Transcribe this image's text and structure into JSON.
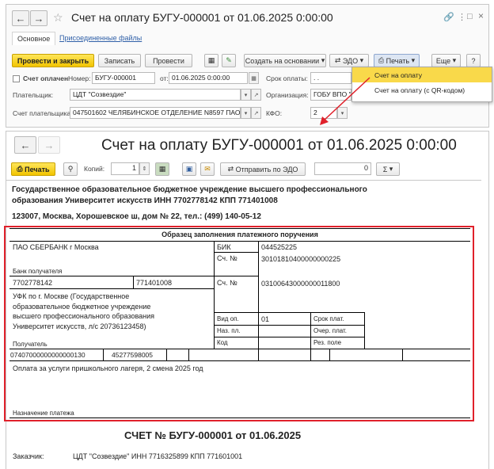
{
  "form": {
    "title": "Счет на оплату БУГУ-000001 от 01.06.2025 0:00:00",
    "tabs": [
      "Основное",
      "Присоединенные файлы"
    ],
    "toolbar": {
      "post_close": "Провести и закрыть",
      "save": "Записать",
      "post": "Провести",
      "create_based": "Создать на основании",
      "edo": "ЭДО",
      "print": "Печать",
      "more": "Еще",
      "help": "?"
    },
    "fields": {
      "paid_label": "Счет оплачен",
      "number_label": "Номер:",
      "number_value": "БУГУ-000001",
      "date_label": "от:",
      "date_value": "01.06.2025  0:00:00",
      "due_label": "Срок оплаты:",
      "due_value": " .  .",
      "payer_label": "Плательщик:",
      "payer_value": "ЦДТ \"Созвездие\"",
      "org_label": "Организация:",
      "org_value": "ГОБУ ВПО \"У",
      "account_label": "Счет плательщика:",
      "account_value": "047501602 ЧЕЛЯБИНСКОЕ ОТДЕЛЕНИЕ N8597 ПАО",
      "kfo_label": "КФО:",
      "kfo_value": "2"
    },
    "print_menu": [
      "Счет на оплату",
      "Счет на оплату (с QR-кодом)"
    ]
  },
  "print_form": {
    "title": "Счет на оплату БУГУ-000001 от 01.06.2025 0:00:00",
    "toolbar": {
      "print": "Печать",
      "copies_label": "Копий:",
      "copies_value": "1",
      "send_edo": "Отправить по ЭДО",
      "counter_value": "0",
      "sum_label": "Σ"
    },
    "org_line1": "Государственное образовательное бюджетное учреждение высшего профессионального",
    "org_line2": "образования  Университет искусств ИНН 7702778142 КПП 771401008",
    "org_address": "123007, Москва, Хорошевское ш, дом № 22, тел.: (499) 140-05-12",
    "payment": {
      "heading": "Образец заполнения платежного поручения",
      "bank_name": "ПАО СБЕРБАНК г Москва",
      "bank_label": "Банк получателя",
      "bik_label": "БИК",
      "bik_value": "044525225",
      "corr_label": "Сч. №",
      "corr_value": "30101810400000000225",
      "inn": "7702778142",
      "kpp": "771401008",
      "acc_label": "Сч. №",
      "acc_value": "03100643000000011800",
      "recipient_lines": [
        "УФК по г. Москве (Государственное",
        "образовательное бюджетное учреждение",
        "высшего профессионального образования",
        "Университет искусств, л/с 20736123458)"
      ],
      "recipient_label": "Получатель",
      "vid_label": "Вид оп.",
      "vid_value": "01",
      "naz_label": "Наз. пл.",
      "kod_label": "Код",
      "srok_label": "Срок плат.",
      "ocher_label": "Очер. плат.",
      "rez_label": "Рез. поле",
      "kbk": "07407000000000000130",
      "oktmo": "45277598005",
      "purpose_text": "Оплата за услуги пришкольного лагеря, 2 смена 2025 год",
      "purpose_label": "Назначение платежа"
    },
    "invoice_title": "СЧЕТ № БУГУ-000001 от 01.06.2025",
    "customer_label": "Заказчик:",
    "customer_value": "ЦДТ \"Созвездие\"  ИНН 7716325899 КПП 771601001"
  },
  "colors": {
    "accent_yellow": "#f2c400",
    "highlight_red": "#e0212b",
    "link_blue": "#3060a8"
  }
}
